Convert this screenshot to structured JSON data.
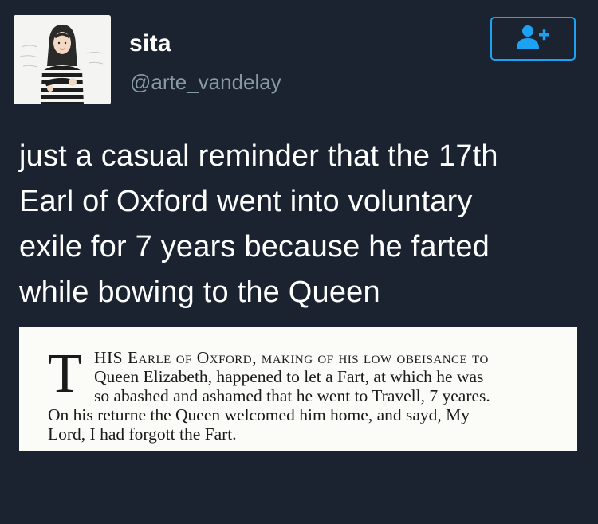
{
  "user": {
    "display_name": "sita",
    "handle": "@arte_vandelay",
    "avatar": "avatar-drawing"
  },
  "follow_button": {
    "icon": "add-user-icon",
    "accent_color": "#1da1f2"
  },
  "tweet": {
    "lines": [
      "just a casual reminder that the 17th",
      "Earl of Oxford went into voluntary",
      "exile for 7 years because he farted",
      "while bowing to the Queen"
    ]
  },
  "attached_image": {
    "drop_cap": "T",
    "lines": [
      "HIS Earle of Oxford, making of his low obeisance to",
      "Queen Elizabeth, happened to let a Fart, at which he was",
      "so abashed and ashamed that he went to Travell, 7 yeares.",
      "On his returne the Queen welcomed him home, and sayd, My",
      "Lord, I had forgott the Fart."
    ]
  },
  "colors": {
    "background": "#1b2330",
    "handle": "#8899a6",
    "text": "#ffffff"
  }
}
